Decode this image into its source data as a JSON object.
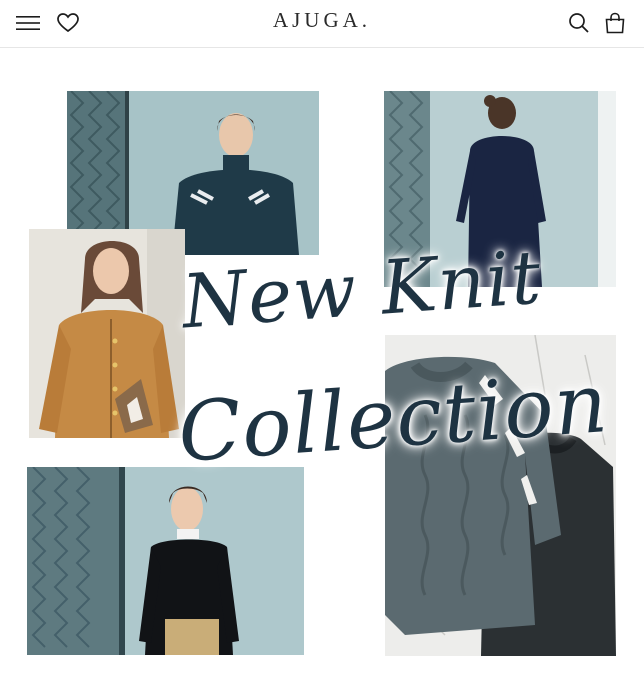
{
  "header": {
    "logo": "AJUGA.",
    "icons": {
      "menu": "hamburger-menu-icon",
      "wishlist": "heart-icon",
      "search": "search-icon",
      "cart": "shopping-bag-icon"
    }
  },
  "hero": {
    "headline_line1": "New Knit",
    "headline_line2": "Collection",
    "colors": {
      "headline": "#1e3342",
      "wall": "#a9c7cc",
      "navy_knit": "#1b2740",
      "camel": "#c58a45",
      "grey_knit": "#5b6a70"
    }
  }
}
